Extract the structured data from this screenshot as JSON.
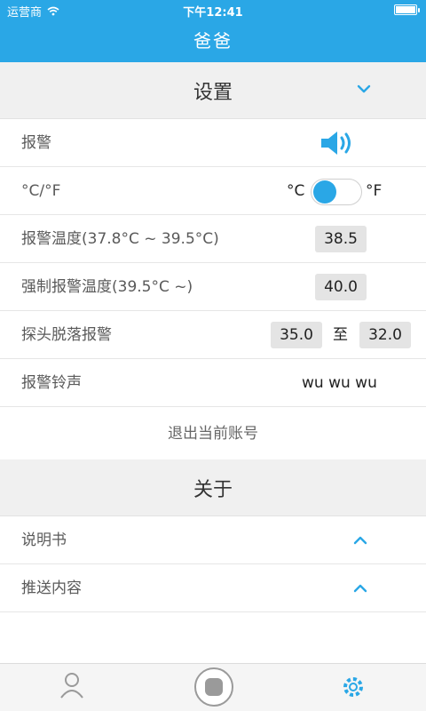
{
  "status_bar": {
    "carrier": "运营商",
    "time": "下午12:41"
  },
  "nav": {
    "title": "爸爸"
  },
  "settings": {
    "header": "设置",
    "alarm": {
      "label": "报警",
      "icon": "speaker-icon"
    },
    "unit": {
      "label": "°C/°F",
      "left": "°C",
      "right": "°F",
      "selected": "°C"
    },
    "alarm_temp": {
      "label": "报警温度(37.8°C ~ 39.5°C)",
      "value": "38.5"
    },
    "forced_alarm_temp": {
      "label": "强制报警温度(39.5°C ~)",
      "value": "40.0"
    },
    "probe_off_alarm": {
      "label": "探头脱落报警",
      "from": "35.0",
      "to_label": "至",
      "to": "32.0"
    },
    "ringtone": {
      "label": "报警铃声",
      "value": "wu wu wu"
    },
    "logout": "退出当前账号"
  },
  "about": {
    "header": "关于",
    "items": [
      {
        "label": "说明书"
      },
      {
        "label": "推送内容"
      }
    ]
  },
  "tabbar": {
    "tabs": [
      {
        "icon": "person-icon"
      },
      {
        "icon": "record-button-icon"
      },
      {
        "icon": "gear-icon"
      }
    ]
  },
  "colors": {
    "accent": "#2aa7e6",
    "section_bg": "#f0f0f0",
    "pill_bg": "#e4e4e4"
  }
}
